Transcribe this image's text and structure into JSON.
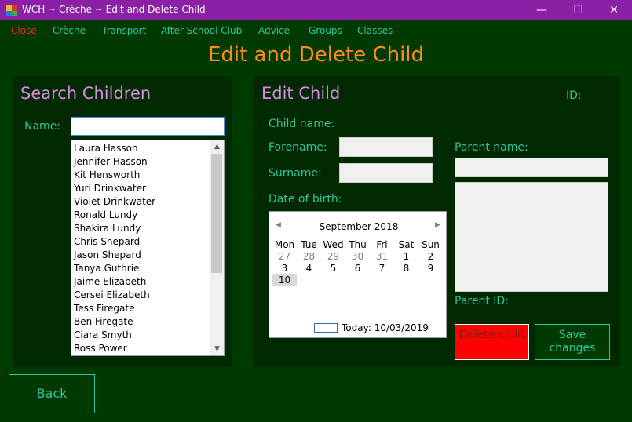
{
  "window": {
    "title": "WCH ~ Crèche ~ Edit and Delete Child",
    "minimize": "—",
    "maximize": "☐",
    "close": "✕"
  },
  "menu": [
    "Close",
    "Crèche",
    "Transport",
    "After School Club",
    "Advice",
    "Groups",
    "Classes"
  ],
  "page_title": "Edit and Delete Child",
  "search": {
    "title": "Search Children",
    "name_label": "Name:",
    "name_value": "",
    "children": [
      "Laura Hasson",
      "Jennifer Hasson",
      "Kit Hensworth",
      "Yuri Drinkwater",
      "Violet Drinkwater",
      "Ronald Lundy",
      "Shakira Lundy",
      "Chris Shepard",
      "Jason Shepard",
      "Tanya Guthrie",
      "Jaime Elizabeth",
      "Cersei Elizabeth",
      "Tess Firegate",
      "Ben Firegate",
      "Ciara Smyth",
      "Ross Power"
    ]
  },
  "edit": {
    "title": "Edit Child",
    "id_label": "ID:",
    "child_name_label": "Child name:",
    "forename_label": "Forename:",
    "forename_value": "",
    "surname_label": "Surname:",
    "surname_value": "",
    "dob_label": "Date of birth:",
    "parent_name_label": "Parent name:",
    "parent_name_value": "",
    "parent_id_label": "Parent ID:",
    "delete_label": "Delete child",
    "save_label": "Save changes"
  },
  "calendar": {
    "month": "September 2018",
    "weekdays": [
      "Mon",
      "Tue",
      "Wed",
      "Thu",
      "Fri",
      "Sat",
      "Sun"
    ],
    "weeks": [
      [
        "27",
        "28",
        "29",
        "30",
        "31",
        "1",
        "2"
      ],
      [
        "3",
        "4",
        "5",
        "6",
        "7",
        "8",
        "9"
      ],
      [
        "10",
        "",
        "",
        "",
        "",
        "",
        ""
      ]
    ],
    "selected": "10",
    "today": "Today: 10/03/2019"
  },
  "back_label": "Back",
  "colors": {
    "background": "#003a00",
    "panel": "#002900",
    "titlebar": "#8b1fa6",
    "accent_teal": "#2ac7a0",
    "heading_orange": "#ff8c1a",
    "panel_title_pink": "#d98ae6",
    "delete_red": "#ff0000",
    "menu_close_red": "#ff2020"
  }
}
